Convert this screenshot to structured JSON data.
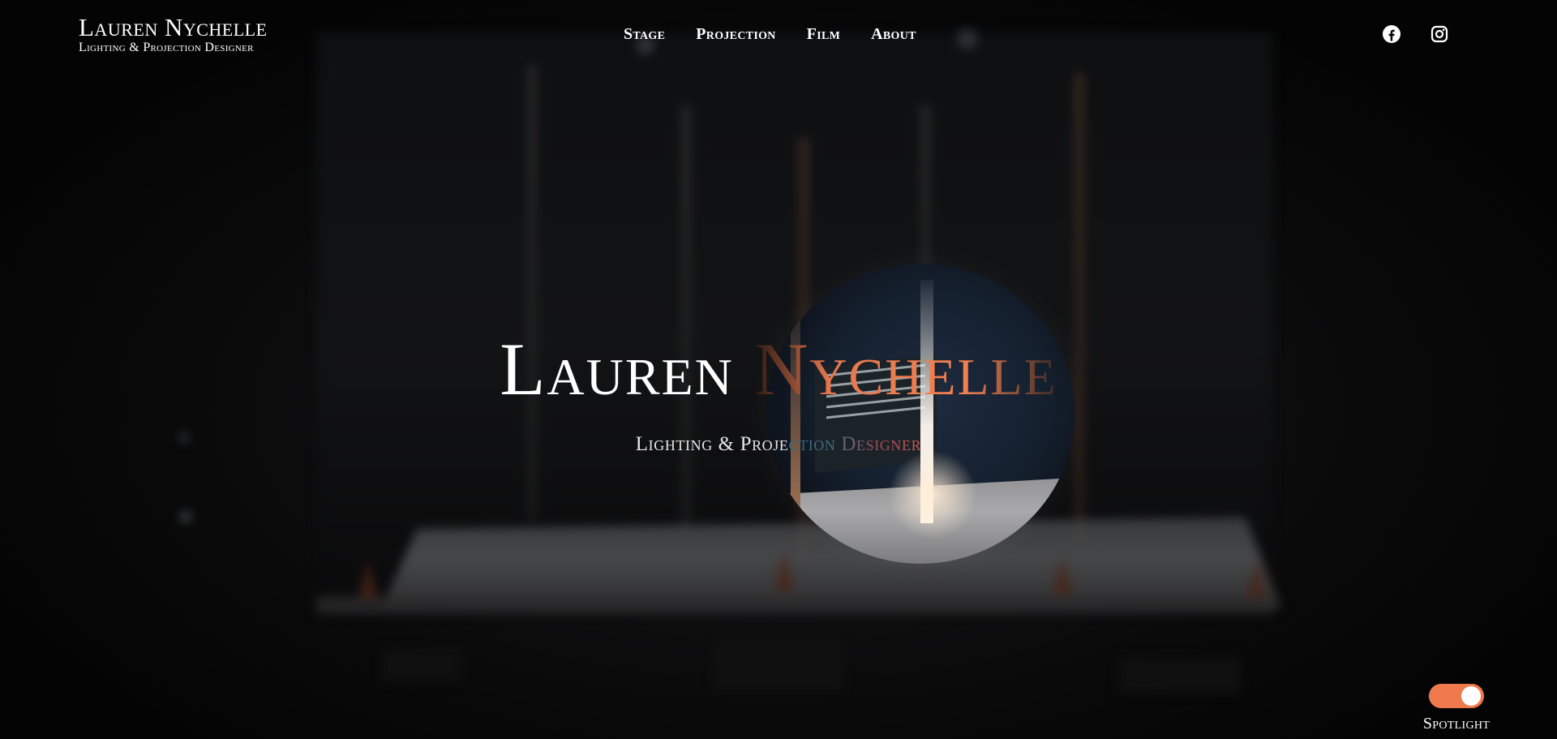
{
  "brand": {
    "name": "Lauren Nychelle",
    "tagline": "Lighting & Projection Designer"
  },
  "nav": {
    "items": [
      {
        "label": "Stage"
      },
      {
        "label": "Projection"
      },
      {
        "label": "Film"
      },
      {
        "label": "About"
      }
    ]
  },
  "social": {
    "items": [
      {
        "icon": "facebook-icon"
      },
      {
        "icon": "instagram-icon"
      }
    ]
  },
  "hero": {
    "title_first": "Lauren",
    "title_accent": "Nychelle",
    "subtitle_head": "Lighting & Proje",
    "subtitle_tail": "ction Designer"
  },
  "spotlight_toggle": {
    "label": "Spotlight",
    "on": true
  },
  "colors": {
    "accent": "#f07a4e",
    "background": "#050505",
    "text": "#ffffff"
  }
}
